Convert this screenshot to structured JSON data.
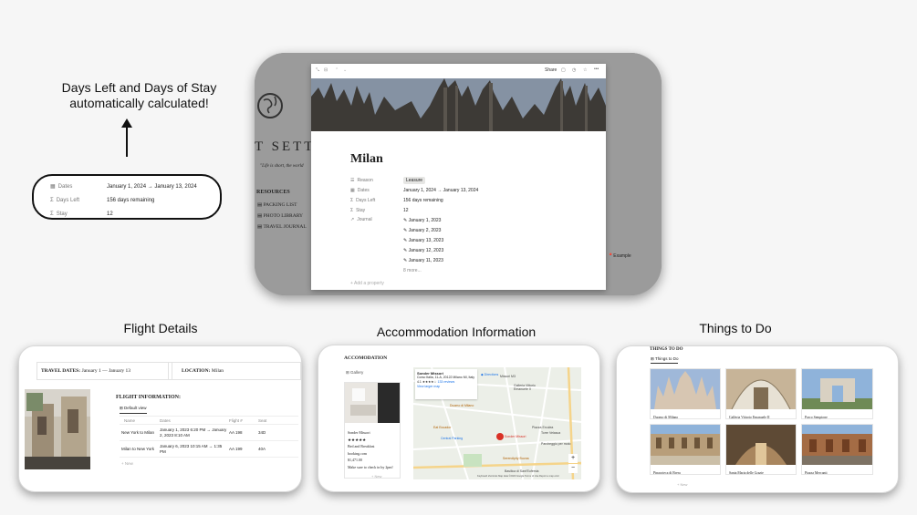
{
  "callout": {
    "line1": "Days Left and Days of Stay",
    "line2": "automatically calculated!",
    "rows": [
      {
        "label": "Dates",
        "value": "January 1, 2024 → January 13, 2024",
        "icon": "calendar-icon"
      },
      {
        "label": "Days Left",
        "value": "156 days remaining",
        "icon": "sigma-icon"
      },
      {
        "label": "Stay",
        "value": "12",
        "icon": "sigma-icon"
      }
    ]
  },
  "bg_page": {
    "title_fragment": "T SETT",
    "quote": "\"Life is short, the world",
    "resources_label": "RESOURCES",
    "links": [
      "PACKING LIST",
      "PHOTO LIBRARY",
      "TRAVEL JOURNAL"
    ],
    "example": "Example"
  },
  "modal": {
    "share": "Share",
    "title": "Milan",
    "props": [
      {
        "label": "Reason",
        "value": "Leasure",
        "tag": true
      },
      {
        "label": "Dates",
        "value": "January 1, 2024 → January 13, 2024"
      },
      {
        "label": "Days Left",
        "value": "156 days remaining"
      },
      {
        "label": "Stay",
        "value": "12"
      }
    ],
    "journal_label": "Journal",
    "journal": [
      "January 1, 2023",
      "January 2, 2023",
      "January 13, 2023",
      "January 12, 2023",
      "January 11, 2023"
    ],
    "more": "8 more...",
    "add_property": "Add a property"
  },
  "sections": {
    "flight": "Flight Details",
    "accommodation": "Accommodation Information",
    "things": "Things to Do"
  },
  "flight": {
    "travel_dates": "TRAVEL DATES:",
    "travel_dates_value": "January 1 — January 13",
    "location": "LOCATION:",
    "location_value": "Milan",
    "info_title": "FLIGHT INFORMATION:",
    "view": "Default view",
    "headers": [
      "Name",
      "Dates",
      "Flight #",
      "Seat"
    ],
    "rows": [
      [
        "New York to Milan",
        "January 1, 2023 6:20 PM → January 2, 2023 8:10 AM",
        "AA 198",
        "34D"
      ],
      [
        "Milan to New York",
        "January 6, 2023 10:15 AM → 1:35 PM",
        "AA 199",
        "40A"
      ]
    ],
    "new": "+ New"
  },
  "accom": {
    "title": "ACCOMODATION",
    "view": "Gallery",
    "hotel_name": "Sonder Missori",
    "stars": "★★★★★",
    "type": "Bed and Breakfast",
    "source": "booking.com",
    "price": "$1,471.00",
    "note": "Make sure to check in by 2pm!",
    "new": "+ New",
    "map_name": "Sonder Missori",
    "map_address": "Corso Italia, 11-A, 20122 Milano MI, Italy",
    "map_rating": "4.1",
    "map_reviews": "133 reviews",
    "map_link": "View larger map",
    "directions": "Directions",
    "map_labels": [
      "Duomo di Milano",
      "Galleria Vittorio Emanuele II",
      "Eat Ecuador",
      "Torre Velasca",
      "Central Parking",
      "Sonder Missori",
      "Parcheggio per moto",
      "Serendipity Buona",
      "Piazza Erculea",
      "Basilica di Sant'Eufemia",
      "Missori M3"
    ],
    "map_footer": "Keyboard shortcuts  Map data ©2023 Google  Terms of Use  Report a map error"
  },
  "things": {
    "title": "THINGS TO DO",
    "view": "Things to Do",
    "items": [
      "Duomo di Milano",
      "Galleria Vittorio Emanuele II",
      "Parco Sempione",
      "Pinacoteca di Brera",
      "Santa Maria delle Grazie",
      "Piazza Mercanti"
    ],
    "new": "+ New"
  }
}
